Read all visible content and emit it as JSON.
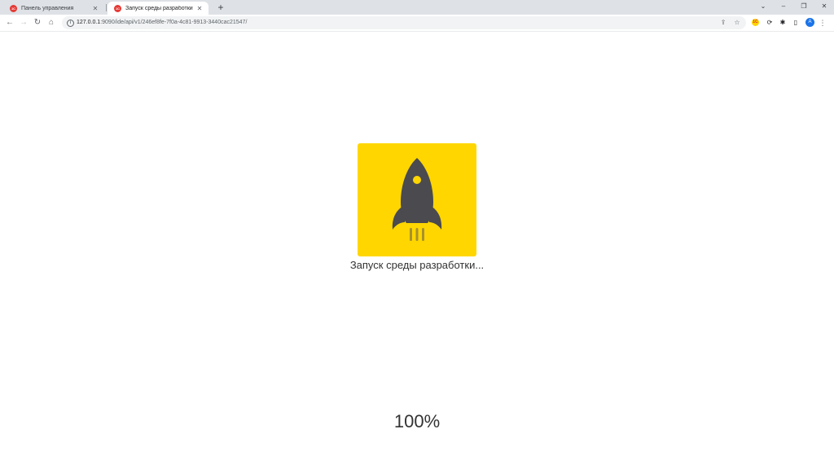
{
  "tabs": [
    {
      "title": "Панель управления",
      "favicon": "1С",
      "active": false
    },
    {
      "title": "Запуск среды разработки",
      "favicon": "1С",
      "active": true
    }
  ],
  "toolbar": {
    "url_host": "127.0.0.1",
    "url_path": ":9090/ide/api/v1/246ef8fe-7f0a-4c81-9913-3440cac21547/"
  },
  "profile": {
    "initial": "A"
  },
  "icons": {
    "back": "arrow-left-icon",
    "forward": "arrow-right-icon",
    "reload": "reload-icon",
    "home": "home-icon",
    "site_info": "info-icon",
    "share": "share-icon",
    "bookmark": "star-icon",
    "extensions": "puzzle-icon",
    "side_panel": "side-panel-icon",
    "menu": "kebab-menu-icon",
    "logo": "rocket-icon"
  },
  "colors": {
    "logo_background": "#ffd600",
    "rocket": "#4a4a4f",
    "favicon": "#e53935"
  },
  "main": {
    "status": "Запуск среды разработки...",
    "progress": "100%"
  }
}
